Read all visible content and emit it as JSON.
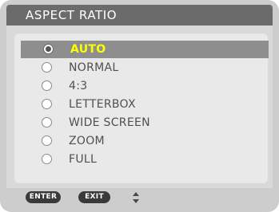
{
  "header": {
    "title": "ASPECT RATIO"
  },
  "options": [
    {
      "label": "AUTO",
      "selected": true
    },
    {
      "label": "NORMAL",
      "selected": false
    },
    {
      "label": "4:3",
      "selected": false
    },
    {
      "label": "LETTERBOX",
      "selected": false
    },
    {
      "label": "WIDE SCREEN",
      "selected": false
    },
    {
      "label": "ZOOM",
      "selected": false
    },
    {
      "label": "FULL",
      "selected": false
    }
  ],
  "footer": {
    "enter_label": "ENTER",
    "exit_label": "EXIT"
  },
  "icons": {
    "radio_selected": "radio-selected-icon",
    "radio_unselected": "radio-unselected-icon",
    "updown": "up-down-arrow-icon"
  },
  "colors": {
    "selected_text": "#ffff00",
    "selected_row": "#8e8e8e",
    "header": "#6b6b6b",
    "text": "#505050"
  }
}
